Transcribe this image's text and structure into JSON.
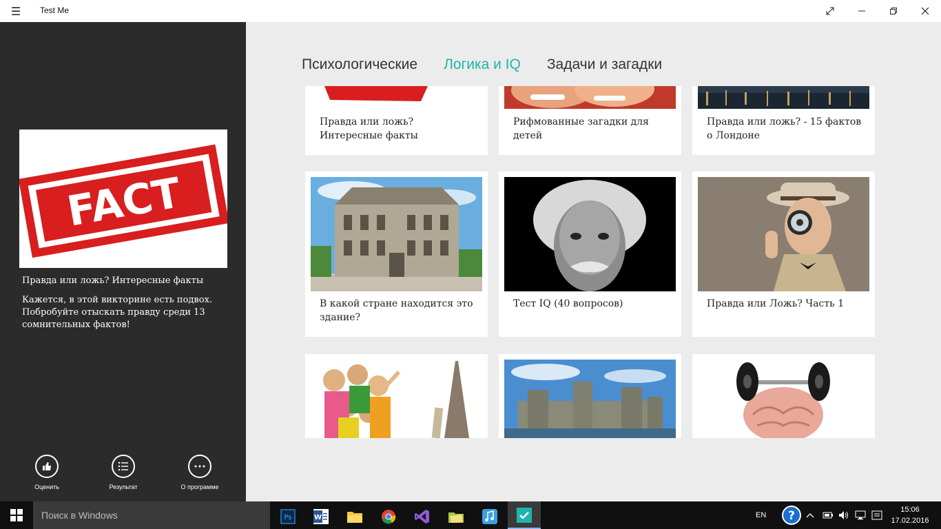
{
  "window": {
    "title": "Test Me",
    "menu_icon": "hamburger-icon",
    "controls": [
      "fullscreen-icon",
      "minimize-icon",
      "restore-icon",
      "close-icon"
    ]
  },
  "sidebar": {
    "selected": {
      "image_text": "FACT",
      "title": "Правда или ложь? Интересные факты",
      "description": "Кажется, в этой викторине есть подвох. Побробуйте отыскать правду среди 13 сомнительных фактов!"
    },
    "actions": [
      {
        "label": "Оценить",
        "icon": "thumbs-up-icon"
      },
      {
        "label": "Результат",
        "icon": "list-icon"
      },
      {
        "label": "О программе",
        "icon": "more-icon"
      }
    ]
  },
  "tabs": [
    {
      "label": "Психологические",
      "active": false
    },
    {
      "label": "Логика и IQ",
      "active": true
    },
    {
      "label": "Задачи и загадки",
      "active": false
    }
  ],
  "cards": [
    {
      "title": "Правда или ложь? Интересные факты",
      "image": "fact-stamp-image"
    },
    {
      "title": "Рифмованные загадки для детей",
      "image": "children-image"
    },
    {
      "title": "Правда или ложь? - 15 фактов о Лондоне",
      "image": "london-night-image"
    },
    {
      "title": "В какой стране находится это здание?",
      "image": "building-image"
    },
    {
      "title": "Тест IQ (40 вопросов)",
      "image": "einstein-image"
    },
    {
      "title": "Правда или Ложь? Часть 1",
      "image": "detective-image"
    },
    {
      "title": "",
      "image": "tourists-image"
    },
    {
      "title": "",
      "image": "castle-image"
    },
    {
      "title": "",
      "image": "brain-dumbbell-image"
    }
  ],
  "taskbar": {
    "search_placeholder": "Поиск в Windows",
    "apps": [
      "photoshop-icon",
      "word-icon",
      "file-explorer-icon",
      "chrome-icon",
      "visual-studio-icon",
      "folder-app-icon",
      "music-app-icon",
      "testme-app-icon"
    ],
    "language": "EN",
    "time": "15:06",
    "date": "17.02.2016"
  },
  "colors": {
    "accent": "#1fb5ac",
    "sidebar_bg": "#2b2b2b",
    "content_bg": "#ececec",
    "taskbar_bg": "#101010"
  }
}
